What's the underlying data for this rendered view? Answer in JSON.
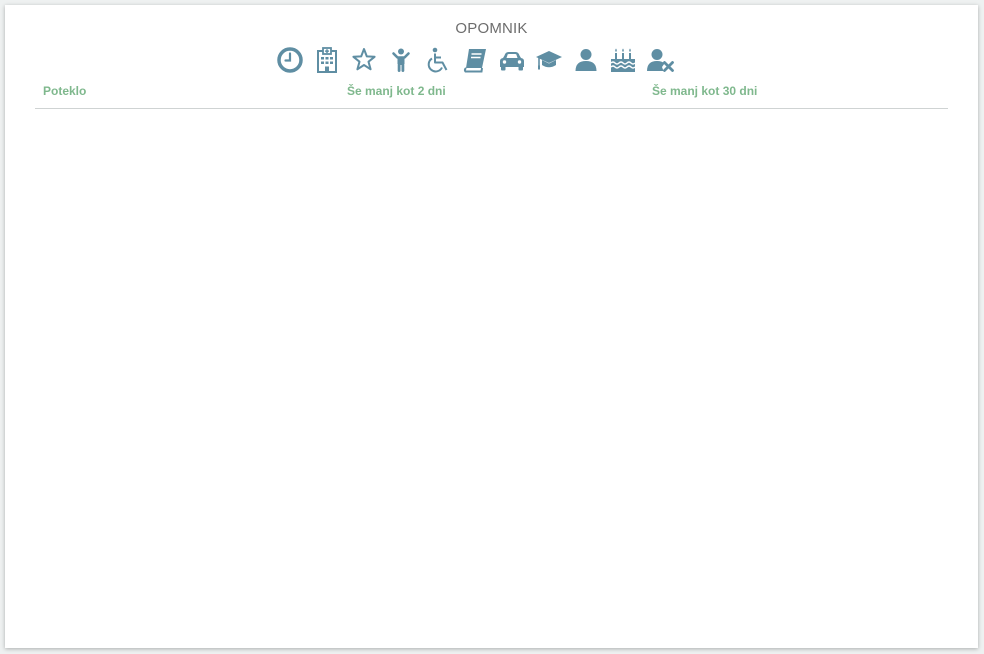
{
  "panel": {
    "title": "OPOMNIK"
  },
  "icons": [
    {
      "name": "clock-icon"
    },
    {
      "name": "hospital-icon"
    },
    {
      "name": "star-icon"
    },
    {
      "name": "child-icon"
    },
    {
      "name": "wheelchair-icon"
    },
    {
      "name": "book-icon"
    },
    {
      "name": "car-icon"
    },
    {
      "name": "graduation-cap-icon"
    },
    {
      "name": "user-icon"
    },
    {
      "name": "birthday-cake-icon"
    },
    {
      "name": "user-remove-icon"
    }
  ],
  "columns": {
    "expired": "Poteklo",
    "less_than_2_days": "Še manj kot 2 dni",
    "less_than_30_days": "Še manj kot 30 dni"
  },
  "colors": {
    "icon": "#5f8ea3",
    "header_text": "#7fb88d",
    "title_text": "#6d6d6d"
  }
}
